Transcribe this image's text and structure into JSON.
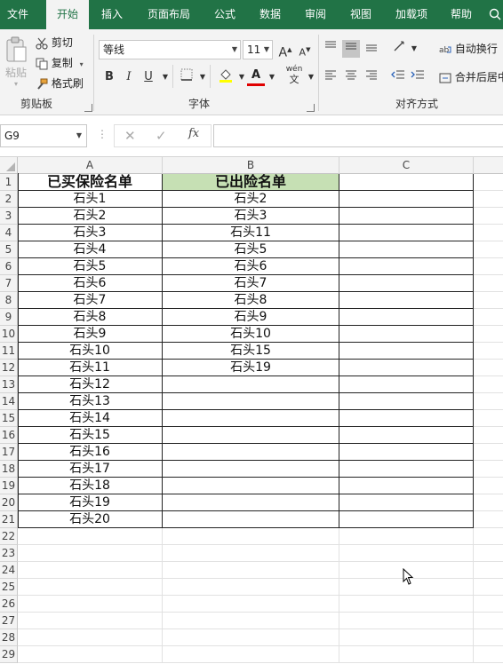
{
  "menu": {
    "items": [
      "文件",
      "开始",
      "插入",
      "页面布局",
      "公式",
      "数据",
      "审阅",
      "视图",
      "加载项",
      "帮助"
    ],
    "active_index": 1
  },
  "ribbon": {
    "clipboard": {
      "paste_label": "粘贴",
      "cut_label": "剪切",
      "copy_label": "复制",
      "format_painter_label": "格式刷",
      "group_label": "剪贴板"
    },
    "font": {
      "font_name": "等线",
      "font_size": "11",
      "bold": "B",
      "italic": "I",
      "underline": "U",
      "group_label": "字体",
      "increase_font": "A",
      "decrease_font": "A",
      "font_color": "A",
      "phonetic": "wén"
    },
    "alignment": {
      "wrap_text_label": "自动换行",
      "merge_center_label": "合并后居中",
      "group_label": "对齐方式"
    }
  },
  "formula_bar": {
    "name_box": "G9",
    "formula": "",
    "fx_label": "fx"
  },
  "sheet": {
    "accent_green": "#217346",
    "highlight_fill": "#c6e0b4",
    "columns": [
      "A",
      "B",
      "C"
    ],
    "row_numbers": [
      "1",
      "2",
      "3",
      "4",
      "5",
      "6",
      "7",
      "8",
      "9",
      "10",
      "11",
      "12",
      "13",
      "14",
      "15",
      "16",
      "17",
      "18",
      "19",
      "20",
      "21",
      "22",
      "23",
      "24",
      "25",
      "26",
      "27",
      "28",
      "29"
    ],
    "header_a": "已买保险名单",
    "header_b": "已出险名单",
    "col_a": [
      "石头1",
      "石头2",
      "石头3",
      "石头4",
      "石头5",
      "石头6",
      "石头7",
      "石头8",
      "石头9",
      "石头10",
      "石头11",
      "石头12",
      "石头13",
      "石头14",
      "石头15",
      "石头16",
      "石头17",
      "石头18",
      "石头19",
      "石头20"
    ],
    "col_b": [
      "石头2",
      "石头3",
      "石头11",
      "石头5",
      "石头6",
      "石头7",
      "石头8",
      "石头9",
      "石头10",
      "石头15",
      "石头19"
    ]
  }
}
